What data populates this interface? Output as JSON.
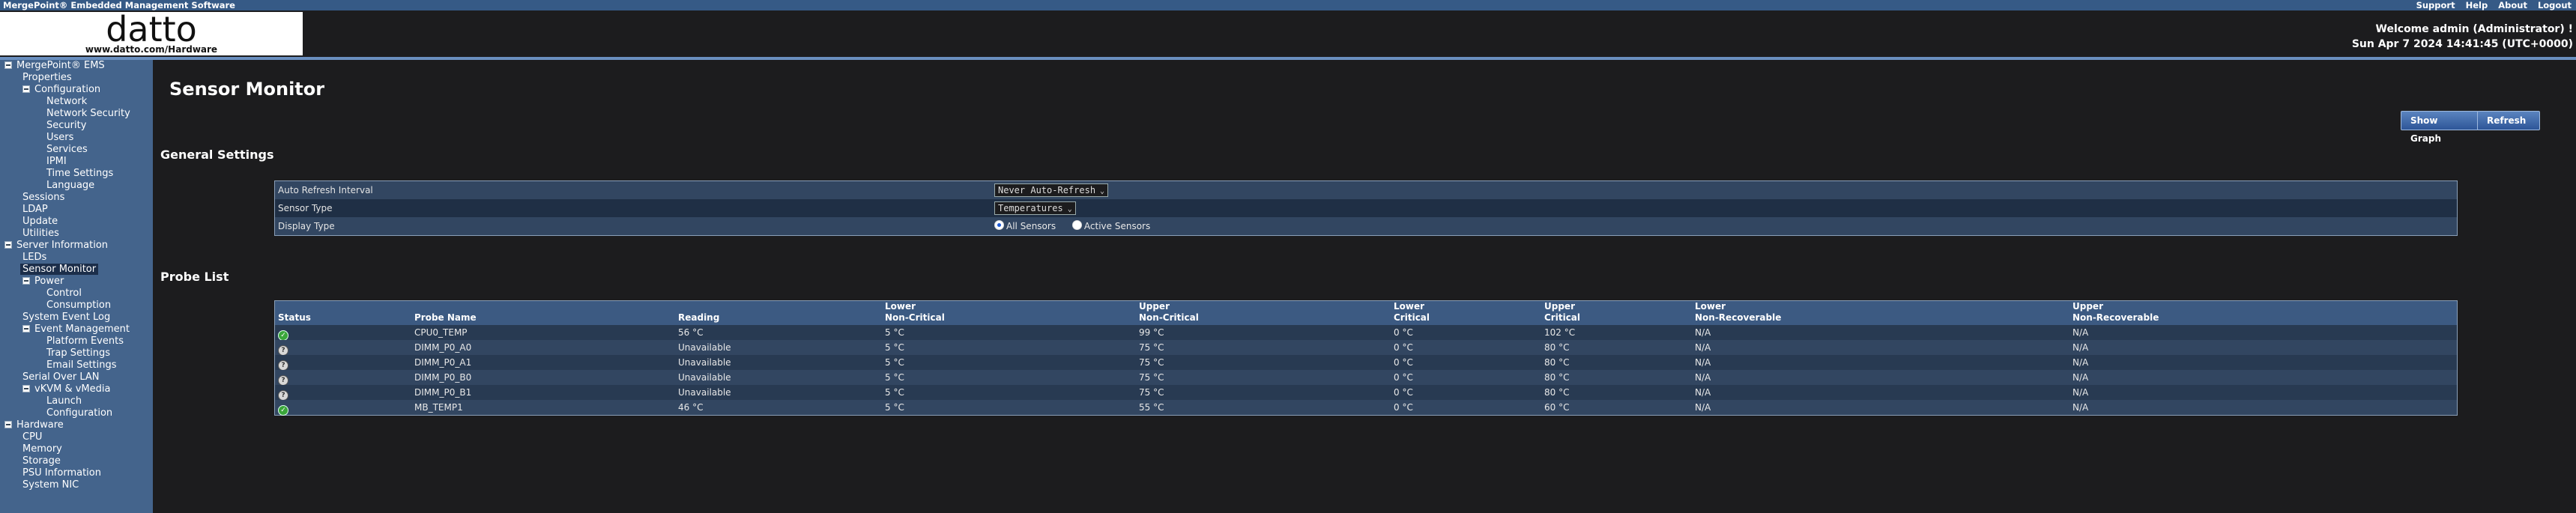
{
  "app": {
    "title": "MergePoint® Embedded Management Software",
    "links": [
      "Support",
      "Help",
      "About",
      "Logout"
    ]
  },
  "header": {
    "logo_text": "datto",
    "logo_url": "www.datto.com/Hardware",
    "welcome": "Welcome admin (Administrator) !",
    "datetime": "Sun Apr 7 2024 14:41:45 (UTC+0000)"
  },
  "sidebar": {
    "items": [
      {
        "label": "MergePoint® EMS",
        "level": 0,
        "toggle": true
      },
      {
        "label": "Properties",
        "level": 1
      },
      {
        "label": "Configuration",
        "level": 1,
        "toggle": true
      },
      {
        "label": "Network",
        "level": 2
      },
      {
        "label": "Network Security",
        "level": 2
      },
      {
        "label": "Security",
        "level": 2
      },
      {
        "label": "Users",
        "level": 2
      },
      {
        "label": "Services",
        "level": 2
      },
      {
        "label": "IPMI",
        "level": 2
      },
      {
        "label": "Time Settings",
        "level": 2
      },
      {
        "label": "Language",
        "level": 2
      },
      {
        "label": "Sessions",
        "level": 1
      },
      {
        "label": "LDAP",
        "level": 1
      },
      {
        "label": "Update",
        "level": 1
      },
      {
        "label": "Utilities",
        "level": 1
      },
      {
        "label": "Server Information",
        "level": 0,
        "toggle": true
      },
      {
        "label": "LEDs",
        "level": 1
      },
      {
        "label": "Sensor Monitor",
        "level": 1,
        "selected": true
      },
      {
        "label": "Power",
        "level": 1,
        "toggle": true
      },
      {
        "label": "Control",
        "level": 2
      },
      {
        "label": "Consumption",
        "level": 2
      },
      {
        "label": "System Event Log",
        "level": 1
      },
      {
        "label": "Event Management",
        "level": 1,
        "toggle": true
      },
      {
        "label": "Platform Events",
        "level": 2
      },
      {
        "label": "Trap Settings",
        "level": 2
      },
      {
        "label": "Email Settings",
        "level": 2
      },
      {
        "label": "Serial Over LAN",
        "level": 1
      },
      {
        "label": "vKVM & vMedia",
        "level": 1,
        "toggle": true
      },
      {
        "label": "Launch",
        "level": 2
      },
      {
        "label": "Configuration",
        "level": 2
      },
      {
        "label": "Hardware",
        "level": 0,
        "toggle": true
      },
      {
        "label": "CPU",
        "level": 1
      },
      {
        "label": "Memory",
        "level": 1
      },
      {
        "label": "Storage",
        "level": 1
      },
      {
        "label": "PSU Information",
        "level": 1
      },
      {
        "label": "System NIC",
        "level": 1
      }
    ]
  },
  "main": {
    "title": "Sensor Monitor",
    "show_graph": "Show Graph",
    "refresh": "Refresh",
    "general_title": "General Settings",
    "probe_title": "Probe List"
  },
  "settings": {
    "auto_refresh_label": "Auto Refresh Interval",
    "auto_refresh_value": "Never Auto-Refresh",
    "sensor_type_label": "Sensor Type",
    "sensor_type_value": "Temperatures",
    "display_type_label": "Display Type",
    "display_all": "All Sensors",
    "display_active": "Active Sensors"
  },
  "probes": {
    "headers": [
      [
        "",
        "Status"
      ],
      [
        "",
        "Probe Name"
      ],
      [
        "",
        "Reading"
      ],
      [
        "Lower",
        "Non-Critical"
      ],
      [
        "Upper",
        "Non-Critical"
      ],
      [
        "Lower",
        "Critical"
      ],
      [
        "Upper",
        "Critical"
      ],
      [
        "Lower",
        "Non-Recoverable"
      ],
      [
        "Upper",
        "Non-Recoverable"
      ]
    ],
    "rows": [
      {
        "status": "ok",
        "cells": [
          "CPU0_TEMP",
          "56 °C",
          "5 °C",
          "99 °C",
          "0 °C",
          "102 °C",
          "N/A",
          "N/A"
        ]
      },
      {
        "status": "unknown",
        "cells": [
          "DIMM_P0_A0",
          "Unavailable",
          "5 °C",
          "75 °C",
          "0 °C",
          "80 °C",
          "N/A",
          "N/A"
        ]
      },
      {
        "status": "unknown",
        "cells": [
          "DIMM_P0_A1",
          "Unavailable",
          "5 °C",
          "75 °C",
          "0 °C",
          "80 °C",
          "N/A",
          "N/A"
        ]
      },
      {
        "status": "unknown",
        "cells": [
          "DIMM_P0_B0",
          "Unavailable",
          "5 °C",
          "75 °C",
          "0 °C",
          "80 °C",
          "N/A",
          "N/A"
        ]
      },
      {
        "status": "unknown",
        "cells": [
          "DIMM_P0_B1",
          "Unavailable",
          "5 °C",
          "75 °C",
          "0 °C",
          "80 °C",
          "N/A",
          "N/A"
        ]
      },
      {
        "status": "ok",
        "cells": [
          "MB_TEMP1",
          "46 °C",
          "5 °C",
          "55 °C",
          "0 °C",
          "60 °C",
          "N/A",
          "N/A"
        ]
      }
    ]
  }
}
